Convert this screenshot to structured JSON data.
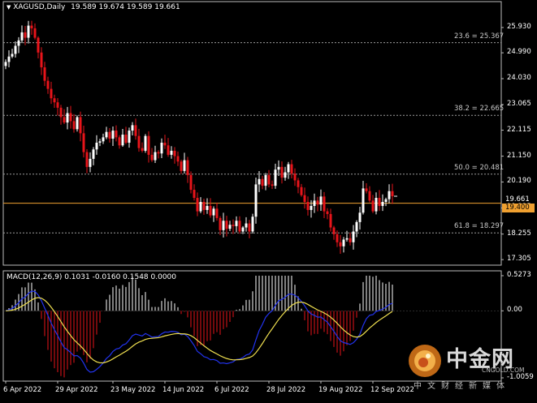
{
  "window": {
    "symbol_title": "XAGUSD,Daily",
    "ohlc": "19.589 19.674 19.589 19.661",
    "indicator_title": "MACD(12,26,9) 0.1031 -0.0160 0.1548 0.0000"
  },
  "colors": {
    "background": "#000000",
    "bull_candle": "#ffffff",
    "bear_candle": "#e8141a",
    "current_price_line": "#f0a030",
    "fib_line": "#9a9a9a",
    "macd_line": "#2233ee",
    "signal_line": "#f0e050",
    "hist_pos": "#ffffff",
    "hist_neg": "#e8141a"
  },
  "chart_data": [
    {
      "type": "candlestick",
      "title": "XAGUSD,Daily",
      "price_axis": [
        "25.930",
        "24.990",
        "24.030",
        "23.065",
        "22.115",
        "21.150",
        "20.190",
        "19.225",
        "18.255",
        "17.305"
      ],
      "time_axis": [
        "6 Apr 2022",
        "29 Apr 2022",
        "23 May 2022",
        "14 Jun 2022",
        "6 Jul 2022",
        "28 Jul 2022",
        "19 Aug 2022",
        "12 Sep 2022"
      ],
      "ylim": [
        17.1,
        26.5
      ],
      "current_price": "19.661",
      "horizontal_line": "19.400",
      "fib_levels": [
        {
          "label": "23.6 = 25.367",
          "value": 25.367
        },
        {
          "label": "38.2 = 22.665",
          "value": 22.665
        },
        {
          "label": "50.0 = 20.481",
          "value": 20.481
        },
        {
          "label": "61.8 = 18.297",
          "value": 18.297
        }
      ],
      "closes": [
        24.65,
        24.85,
        24.95,
        25.25,
        25.45,
        25.75,
        25.55,
        26.0,
        25.9,
        25.55,
        25.0,
        24.45,
        23.95,
        23.65,
        23.3,
        23.15,
        22.95,
        22.6,
        22.4,
        22.75,
        22.45,
        22.15,
        22.6,
        22.0,
        21.3,
        20.75,
        21.05,
        21.4,
        21.65,
        21.7,
        21.85,
        22.05,
        21.8,
        22.1,
        21.85,
        21.55,
        21.95,
        21.65,
        22.1,
        22.3,
        21.9,
        21.45,
        21.35,
        21.9,
        21.2,
        21.0,
        21.3,
        21.25,
        21.65,
        21.55,
        21.2,
        21.35,
        21.15,
        20.95,
        20.6,
        21.0,
        20.45,
        19.9,
        19.6,
        19.1,
        19.45,
        19.15,
        19.3,
        18.95,
        19.2,
        18.85,
        18.4,
        18.75,
        18.45,
        18.6,
        18.55,
        18.75,
        18.35,
        18.5,
        18.65,
        18.35,
        18.9,
        20.1,
        20.3,
        20.05,
        20.45,
        20.1,
        20.05,
        20.65,
        20.75,
        20.35,
        20.55,
        20.85,
        20.5,
        20.25,
        20.0,
        19.7,
        19.45,
        19.15,
        19.3,
        19.5,
        19.35,
        19.65,
        19.1,
        19.0,
        18.5,
        18.25,
        17.95,
        17.8,
        18.05,
        18.1,
        17.95,
        18.35,
        18.7,
        19.05,
        19.95,
        19.85,
        19.5,
        19.1,
        19.6,
        19.3,
        19.45,
        19.55,
        19.85,
        19.661
      ]
    },
    {
      "type": "macd",
      "title": "MACD(12,26,9)",
      "values": {
        "main": "0.1031",
        "signal": "-0.0160",
        "histogram": "0.1548",
        "extra": "0.0000"
      },
      "y_axis": [
        "0.5273",
        "0.00",
        "-1.0059"
      ],
      "ylim": [
        -1.0059,
        0.5273
      ]
    }
  ],
  "watermark": {
    "name": "中金网",
    "url": "CNGOLD.COM",
    "slogan": "中文财经新媒体"
  }
}
